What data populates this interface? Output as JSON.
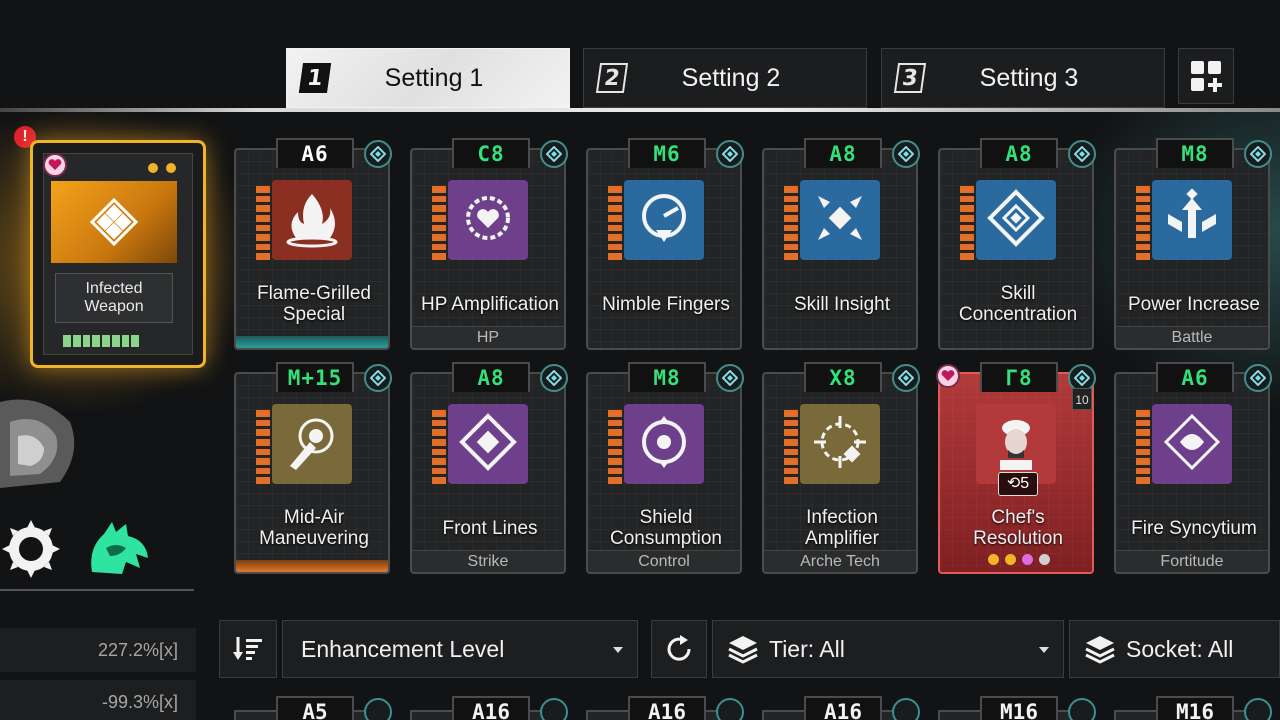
{
  "tabs": [
    {
      "number": "1",
      "label": "Setting 1",
      "active": true
    },
    {
      "number": "2",
      "label": "Setting 2",
      "active": false
    },
    {
      "number": "3",
      "label": "Setting 3",
      "active": false
    }
  ],
  "grid_button": {
    "icon": "grid-plus-icon"
  },
  "weapon": {
    "name": "Infected Weapon",
    "alert": "!",
    "icon": "diamond-cluster-icon",
    "accent": "#f0b429"
  },
  "stats": [
    "227.2%[x]",
    "-99.3%[x]"
  ],
  "chips": [
    {
      "tier": "A6",
      "tier_color": "#ffffff",
      "title": "Flame-Grilled Special",
      "category": "",
      "icon": "flame-icon",
      "icon_bg": "#8b2f22",
      "bottom": "teal"
    },
    {
      "tier": "C8",
      "tier_color": "#34e07a",
      "title": "HP Amplification",
      "category": "HP",
      "icon": "heart-gear-icon",
      "icon_bg": "#6e3f8a",
      "bottom": ""
    },
    {
      "tier": "M6",
      "tier_color": "#34e07a",
      "title": "Nimble Fingers",
      "category": "",
      "icon": "dial-arrow-icon",
      "icon_bg": "#2b6a9e",
      "bottom": ""
    },
    {
      "tier": "A8",
      "tier_color": "#34e07a",
      "title": "Skill Insight",
      "category": "",
      "icon": "sparkle-arrows-icon",
      "icon_bg": "#2b6a9e",
      "bottom": ""
    },
    {
      "tier": "A8",
      "tier_color": "#34e07a",
      "title": "Skill Concentration",
      "category": "",
      "icon": "diamond-frame-icon",
      "icon_bg": "#2b6a9e",
      "bottom": ""
    },
    {
      "tier": "M8",
      "tier_color": "#34e07a",
      "title": "Power Increase",
      "category": "Battle",
      "icon": "fist-up-icon",
      "icon_bg": "#2b6a9e",
      "bottom": ""
    },
    {
      "tier": "M+15",
      "tier_color": "#34e07a",
      "title": "Mid-Air Maneuvering",
      "category": "",
      "icon": "target-hand-icon",
      "icon_bg": "#7a6a3a",
      "bottom": "orange"
    },
    {
      "tier": "A8",
      "tier_color": "#34e07a",
      "title": "Front Lines",
      "category": "Strike",
      "icon": "diamond-burst-icon",
      "icon_bg": "#6e3f8a",
      "bottom": ""
    },
    {
      "tier": "M8",
      "tier_color": "#34e07a",
      "title": "Shield Consumption",
      "category": "Control",
      "icon": "shield-cycle-icon",
      "icon_bg": "#6e3f8a",
      "bottom": ""
    },
    {
      "tier": "X8",
      "tier_color": "#34e07a",
      "title": "Infection Amplifier",
      "category": "Arche Tech",
      "icon": "crosshair-diamond-icon",
      "icon_bg": "#7a6a3a",
      "bottom": ""
    },
    {
      "tier": "Γ8",
      "tier_color": "#34e07a",
      "title": "Chef's Resolution",
      "category": "",
      "icon": "chef-portrait-icon",
      "icon_bg": "#b23a3a",
      "bottom": "",
      "special": true,
      "level": "10",
      "cooldown": "5"
    },
    {
      "tier": "A6",
      "tier_color": "#34e07a",
      "title": "Fire Syncytium",
      "category": "Fortitude",
      "icon": "diamond-swirl-icon",
      "icon_bg": "#6e3f8a",
      "bottom": ""
    }
  ],
  "filters": {
    "sort_label": "Enhancement Level",
    "tier_label": "Tier: All",
    "socket_label": "Socket: All"
  },
  "next_row_tiers": [
    "A5",
    "A16",
    "A16",
    "A16",
    "M16",
    "M16"
  ],
  "colors": {
    "accent_green": "#34e07a",
    "pip_orange": "#e36f27",
    "socket_teal": "#3e8f8f",
    "gold": "#f0b429"
  }
}
